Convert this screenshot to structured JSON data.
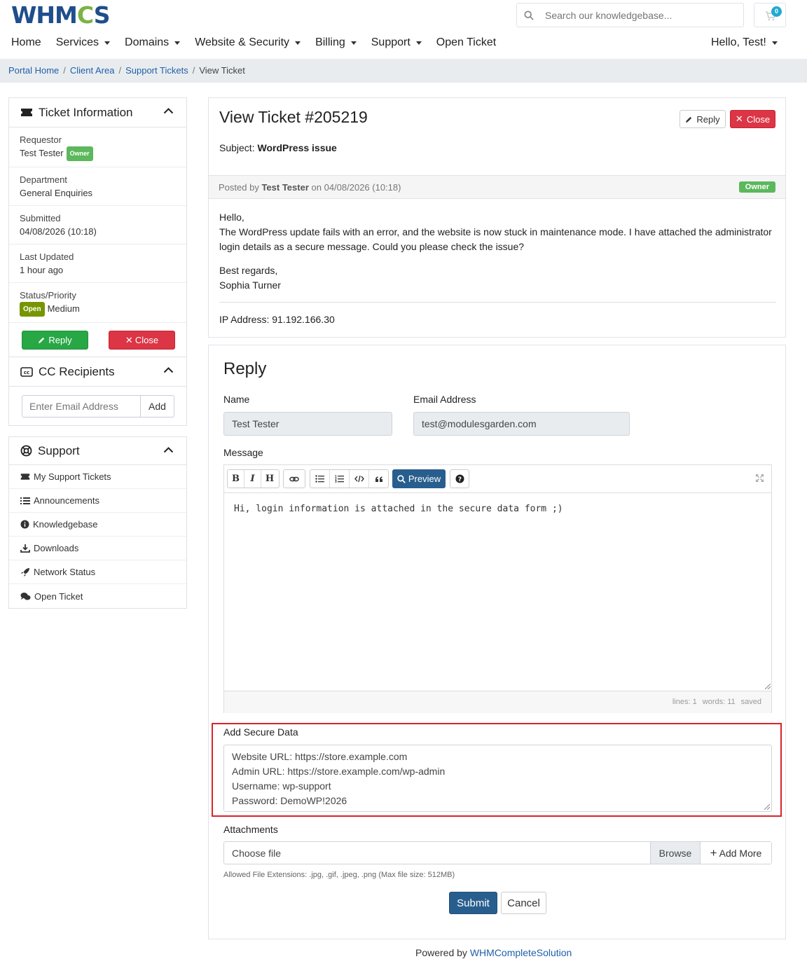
{
  "brand": {
    "logo_left": "WHM",
    "logo_o": "C",
    "logo_right": "S"
  },
  "search": {
    "placeholder": "Search our knowledgebase..."
  },
  "cart": {
    "count": "0"
  },
  "nav": {
    "items": [
      {
        "label": "Home",
        "dropdown": false
      },
      {
        "label": "Services",
        "dropdown": true
      },
      {
        "label": "Domains",
        "dropdown": true
      },
      {
        "label": "Website & Security",
        "dropdown": true
      },
      {
        "label": "Billing",
        "dropdown": true
      },
      {
        "label": "Support",
        "dropdown": true
      },
      {
        "label": "Open Ticket",
        "dropdown": false
      }
    ],
    "user_greeting": "Hello, Test!"
  },
  "breadcrumb": [
    "Portal Home",
    "Client Area",
    "Support Tickets",
    "View Ticket"
  ],
  "ticket_info": {
    "title": "Ticket Information",
    "requestor_label": "Requestor",
    "requestor_value": "Test Tester",
    "owner_badge": "Owner",
    "department_label": "Department",
    "department_value": "General Enquiries",
    "submitted_label": "Submitted",
    "submitted_value": "04/08/2026 (10:18)",
    "updated_label": "Last Updated",
    "updated_value": "1 hour ago",
    "status_label": "Status/Priority",
    "status_badge": "Open",
    "priority_value": "Medium",
    "reply_label": "Reply",
    "close_label": "Close"
  },
  "cc": {
    "title": "CC Recipients",
    "placeholder": "Enter Email Address",
    "add_label": "Add"
  },
  "support": {
    "title": "Support",
    "items": [
      "My Support Tickets",
      "Announcements",
      "Knowledgebase",
      "Downloads",
      "Network Status",
      "Open Ticket"
    ]
  },
  "ticket": {
    "title": "View Ticket #205219",
    "reply_label": "Reply",
    "close_label": "Close",
    "subject_label": "Subject:",
    "subject_value": "WordPress issue",
    "posted_prefix": "Posted by",
    "posted_author": "Test Tester",
    "posted_suffix": "on 04/08/2026 (10:18)",
    "owner_badge": "Owner",
    "message_greeting": "Hello,",
    "message_body": "The WordPress update fails with an error, and the website is now stuck in maintenance mode. I have attached the administrator login details as a secure message. Could you please check the issue?",
    "message_signoff": "Best regards,",
    "message_name": "Sophia Turner",
    "ip_label": "IP Address:",
    "ip_value": "91.192.166.30"
  },
  "reply_form": {
    "title": "Reply",
    "name_label": "Name",
    "name_value": "Test Tester",
    "email_label": "Email Address",
    "email_value": "test@modulesgarden.com",
    "message_label": "Message",
    "preview_label": "Preview",
    "message_text": "Hi, login information is attached in the secure data form ;)",
    "status_lines": "lines: 1",
    "status_words": "words: 11",
    "status_saved": "saved",
    "secure_label": "Add Secure Data",
    "secure_lines": [
      "Website URL: https://store.example.com",
      "Admin URL: https://store.example.com/wp-admin",
      "Username: wp-support",
      "Password: DemoWP!2026"
    ],
    "attachments_label": "Attachments",
    "choose_file": "Choose file",
    "browse_label": "Browse",
    "add_more_label": "Add More",
    "allowed_ext": "Allowed File Extensions: .jpg, .gif, .jpeg, .png (Max file size: 512MB)",
    "submit_label": "Submit",
    "cancel_label": "Cancel"
  },
  "footer": {
    "prefix": "Powered by",
    "link": "WHMCompleteSolution"
  },
  "colors": {
    "primary": "#285e8e",
    "danger": "#dc3545",
    "success": "#28a745",
    "highlight": "#d9232d"
  }
}
